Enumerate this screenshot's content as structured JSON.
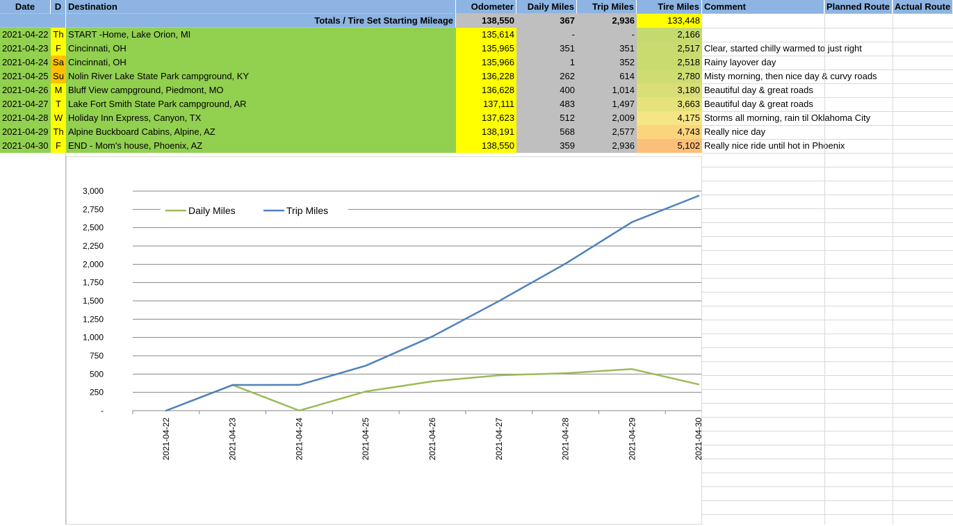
{
  "header": {
    "date": "Date",
    "day": "D",
    "destination": "Destination",
    "odometer": "Odometer",
    "daily_miles": "Daily Miles",
    "trip_miles": "Trip Miles",
    "tire_miles": "Tire Miles",
    "comment": "Comment",
    "planned_route": "Planned Route",
    "actual_route": "Actual Route"
  },
  "totals": {
    "label": "Totals / Tire Set Starting Mileage",
    "odometer": "138,550",
    "daily_miles": "367",
    "trip_miles": "2,936",
    "tire_miles": "133,448"
  },
  "rows": [
    {
      "date": "2021-04-22",
      "day": "Th",
      "destination": "START -Home, Lake Orion, MI",
      "odometer": "135,614",
      "daily": "-",
      "trip": "-",
      "tire": "2,166",
      "comment": "",
      "day_color": "#ffff00",
      "tire_color": "#c4d96e"
    },
    {
      "date": "2021-04-23",
      "day": "F",
      "destination": "Cincinnati, OH",
      "odometer": "135,965",
      "daily": "351",
      "trip": "351",
      "tire": "2,517",
      "comment": "Clear, started chilly warmed to just right",
      "day_color": "#ffff00",
      "tire_color": "#c9da6f"
    },
    {
      "date": "2021-04-24",
      "day": "Sa",
      "destination": "Cincinnati, OH",
      "odometer": "135,966",
      "daily": "1",
      "trip": "352",
      "tire": "2,518",
      "comment": "Rainy layover day",
      "day_color": "#ffc000",
      "tire_color": "#c9da6f"
    },
    {
      "date": "2021-04-25",
      "day": "Su",
      "destination": "Nolin River Lake  State Park campground, KY",
      "odometer": "136,228",
      "daily": "262",
      "trip": "614",
      "tire": "2,780",
      "comment": "Misty morning, then nice day & curvy roads",
      "day_color": "#ffc000",
      "tire_color": "#cfdc72"
    },
    {
      "date": "2021-04-26",
      "day": "M",
      "destination": "Bluff View campground, Piedmont, MO",
      "odometer": "136,628",
      "daily": "400",
      "trip": "1,014",
      "tire": "3,180",
      "comment": "Beautiful day & great roads",
      "day_color": "#ffff00",
      "tire_color": "#d9df76"
    },
    {
      "date": "2021-04-27",
      "day": "T",
      "destination": "Lake Fort Smith State Park campground, AR",
      "odometer": "137,111",
      "daily": "483",
      "trip": "1,497",
      "tire": "3,663",
      "comment": "Beautiful day & great roads",
      "day_color": "#ffff00",
      "tire_color": "#e5e27b"
    },
    {
      "date": "2021-04-28",
      "day": "W",
      "destination": "Holiday Inn Express, Canyon, TX",
      "odometer": "137,623",
      "daily": "512",
      "trip": "2,009",
      "tire": "4,175",
      "comment": "Storms all morning, rain til Oklahoma City",
      "day_color": "#ffff00",
      "tire_color": "#f6e584"
    },
    {
      "date": "2021-04-29",
      "day": "Th",
      "destination": "Alpine Buckboard Cabins, Alpine, AZ",
      "odometer": "138,191",
      "daily": "568",
      "trip": "2,577",
      "tire": "4,743",
      "comment": "Really nice day",
      "day_color": "#ffff00",
      "tire_color": "#fdd47e"
    },
    {
      "date": "2021-04-30",
      "day": "F",
      "destination": "END - Mom's house, Phoenix, AZ",
      "odometer": "138,550",
      "daily": "359",
      "trip": "2,936",
      "tire": "5,102",
      "comment": "Really nice ride until hot in Phoenix",
      "day_color": "#ffff00",
      "tire_color": "#fbbf7b"
    }
  ],
  "chart_data": {
    "type": "line",
    "categories": [
      "2021-04-22",
      "2021-04-23",
      "2021-04-24",
      "2021-04-25",
      "2021-04-26",
      "2021-04-27",
      "2021-04-28",
      "2021-04-29",
      "2021-04-30"
    ],
    "series": [
      {
        "name": "Daily Miles",
        "color": "#9bbb59",
        "values": [
          0,
          351,
          1,
          262,
          400,
          483,
          512,
          568,
          359
        ]
      },
      {
        "name": "Trip Miles",
        "color": "#4f81bd",
        "values": [
          0,
          351,
          352,
          614,
          1014,
          1497,
          2009,
          2577,
          2936
        ]
      }
    ],
    "ylim": [
      0,
      3000
    ],
    "yticks": [
      "-",
      "250",
      "500",
      "750",
      "1,000",
      "1,250",
      "1,500",
      "1,750",
      "2,000",
      "2,250",
      "2,500",
      "2,750",
      "3,000"
    ],
    "grid": true,
    "legend": "top-left"
  }
}
